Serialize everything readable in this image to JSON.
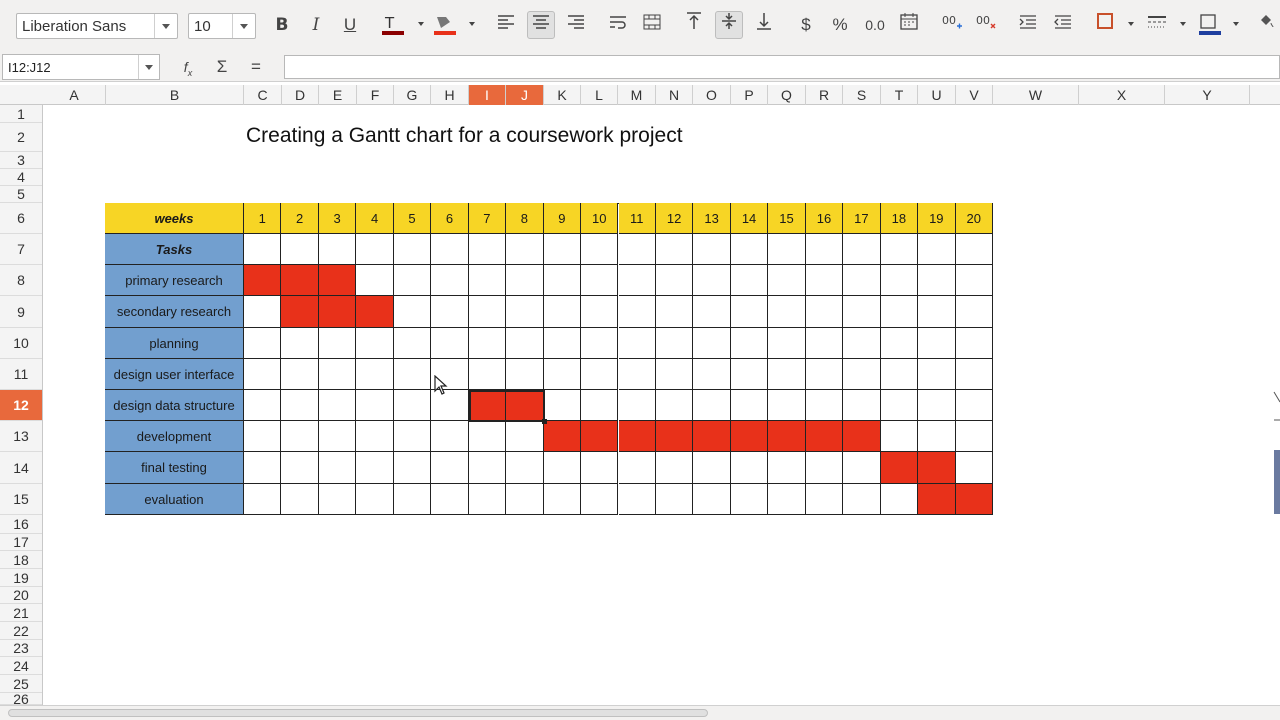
{
  "toolbar": {
    "font_name": "Liberation Sans",
    "font_size": "10",
    "colors": {
      "font_color": "#8b0000",
      "highlight": "#e8311a",
      "border_color": "#c8502a",
      "line_color": "#1f3f9f"
    }
  },
  "formula_bar": {
    "name_box": "I12:J12",
    "formula": ""
  },
  "columns": [
    "A",
    "B",
    "C",
    "D",
    "E",
    "F",
    "G",
    "H",
    "I",
    "J",
    "K",
    "L",
    "M",
    "N",
    "O",
    "P",
    "Q",
    "R",
    "S",
    "T",
    "U",
    "V",
    "W",
    "X",
    "Y"
  ],
  "selected_columns": [
    "I",
    "J"
  ],
  "rows": [
    "1",
    "2",
    "3",
    "4",
    "5",
    "6",
    "7",
    "8",
    "9",
    "10",
    "11",
    "12",
    "13",
    "14",
    "15",
    "16",
    "17",
    "18",
    "19",
    "20",
    "21",
    "22",
    "23",
    "24",
    "25",
    "26"
  ],
  "selected_row": "12",
  "sheet": {
    "title": "Creating a Gantt chart for a coursework project",
    "weeks_label": "weeks",
    "tasks_label": "Tasks",
    "weeks": [
      "1",
      "2",
      "3",
      "4",
      "5",
      "6",
      "7",
      "8",
      "9",
      "10",
      "11",
      "12",
      "13",
      "14",
      "15",
      "16",
      "17",
      "18",
      "19",
      "20"
    ],
    "tasks": [
      {
        "name": "primary research",
        "start": 1,
        "end": 3
      },
      {
        "name": "secondary research",
        "start": 2,
        "end": 4
      },
      {
        "name": "planning",
        "start": null,
        "end": null
      },
      {
        "name": "design user interface",
        "start": null,
        "end": null
      },
      {
        "name": "design data structure",
        "start": 7,
        "end": 8
      },
      {
        "name": "development",
        "start": 9,
        "end": 17
      },
      {
        "name": "final testing",
        "start": 18,
        "end": 19
      },
      {
        "name": "evaluation",
        "start": 19,
        "end": 20
      }
    ],
    "colors": {
      "header_bg": "#f7d525",
      "task_bg": "#729fcf",
      "bar": "#e8311a"
    }
  }
}
